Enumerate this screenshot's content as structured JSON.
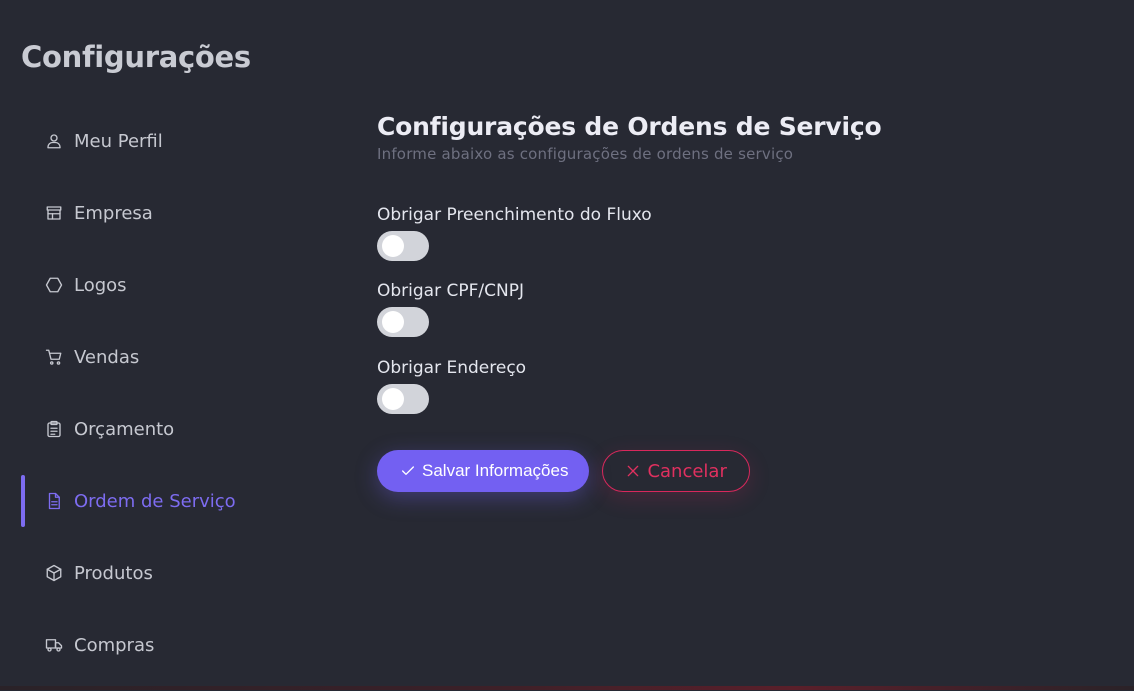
{
  "page": {
    "title": "Configurações"
  },
  "sidebar": {
    "items": [
      {
        "label": "Meu Perfil",
        "icon": "user-icon",
        "active": false
      },
      {
        "label": "Empresa",
        "icon": "store-icon",
        "active": false
      },
      {
        "label": "Logos",
        "icon": "hexagon-icon",
        "active": false
      },
      {
        "label": "Vendas",
        "icon": "cart-icon",
        "active": false
      },
      {
        "label": "Orçamento",
        "icon": "clipboard-icon",
        "active": false
      },
      {
        "label": "Ordem de Serviço",
        "icon": "document-icon",
        "active": true
      },
      {
        "label": "Produtos",
        "icon": "box-icon",
        "active": false
      },
      {
        "label": "Compras",
        "icon": "truck-icon",
        "active": false
      }
    ]
  },
  "main": {
    "title": "Configurações de Ordens de Serviço",
    "subtitle": "Informe abaixo as configurações de ordens de serviço",
    "fields": [
      {
        "label": "Obrigar Preenchimento do Fluxo",
        "enabled": false
      },
      {
        "label": "Obrigar CPF/CNPJ",
        "enabled": false
      },
      {
        "label": "Obrigar Endereço",
        "enabled": false
      }
    ],
    "save_label": "Salvar Informações",
    "cancel_label": "Cancelar"
  },
  "colors": {
    "background": "#272933",
    "accent": "#7360f2",
    "danger": "#e0305f",
    "toggle_off": "#d2d4da"
  }
}
